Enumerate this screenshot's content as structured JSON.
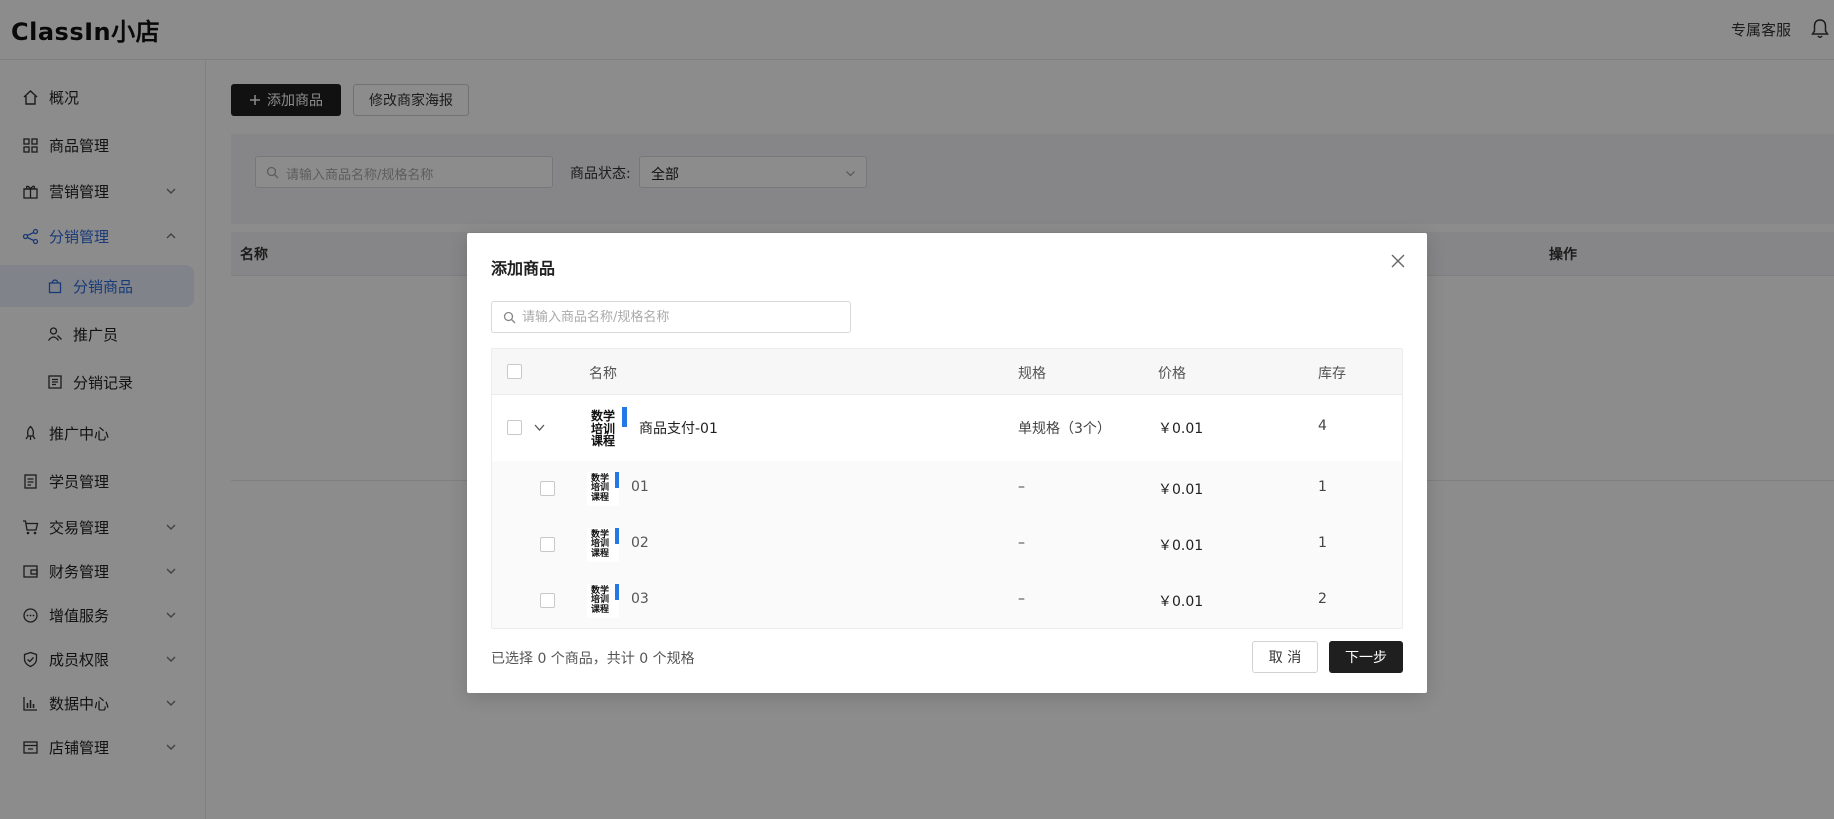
{
  "header": {
    "brand": "ClassIn小店",
    "service_label": "专属客服"
  },
  "sidebar": {
    "items": [
      {
        "label": "概况",
        "icon": "home-icon"
      },
      {
        "label": "商品管理",
        "icon": "grid-icon"
      },
      {
        "label": "营销管理",
        "icon": "gift-icon"
      },
      {
        "label": "分销管理",
        "icon": "share-icon"
      },
      {
        "label": "推广中心",
        "icon": "rocket-icon"
      },
      {
        "label": "学员管理",
        "icon": "document-icon"
      },
      {
        "label": "交易管理",
        "icon": "cart-icon"
      },
      {
        "label": "财务管理",
        "icon": "wallet-icon"
      },
      {
        "label": "增值服务",
        "icon": "chat-icon"
      },
      {
        "label": "成员权限",
        "icon": "shield-icon"
      },
      {
        "label": "数据中心",
        "icon": "chart-icon"
      },
      {
        "label": "店铺管理",
        "icon": "store-icon"
      }
    ],
    "sub_items": [
      {
        "label": "分销商品",
        "icon": "bag-icon"
      },
      {
        "label": "推广员",
        "icon": "users-icon"
      },
      {
        "label": "分销记录",
        "icon": "list-icon"
      }
    ]
  },
  "main": {
    "add_product_button": "添加商品",
    "edit_poster_button": "修改商家海报",
    "search_placeholder": "请输入商品名称/规格名称",
    "status_label": "商品状态:",
    "status_value": "全部",
    "table_headers": {
      "name": "名称",
      "actions": "操作"
    }
  },
  "modal": {
    "title": "添加商品",
    "search_placeholder": "请输入商品名称/规格名称",
    "columns": {
      "name": "名称",
      "spec": "规格",
      "price": "价格",
      "stock": "库存"
    },
    "product": {
      "name": "商品支付-01",
      "spec": "单规格（3个）",
      "price": "￥0.01",
      "stock": "4",
      "thumb_text": "数学培训课程"
    },
    "variants": [
      {
        "name": "01",
        "spec": "–",
        "price": "￥0.01",
        "stock": "1"
      },
      {
        "name": "02",
        "spec": "–",
        "price": "￥0.01",
        "stock": "1"
      },
      {
        "name": "03",
        "spec": "–",
        "price": "￥0.01",
        "stock": "2"
      }
    ],
    "summary": "已选择 0 个商品，共计 0 个规格",
    "cancel_label": "取 消",
    "next_label": "下一步"
  },
  "colors": {
    "accent": "#2f6bd8",
    "dark_button": "#1f1f1f",
    "overlay": "rgba(0,0,0,0.45)"
  }
}
